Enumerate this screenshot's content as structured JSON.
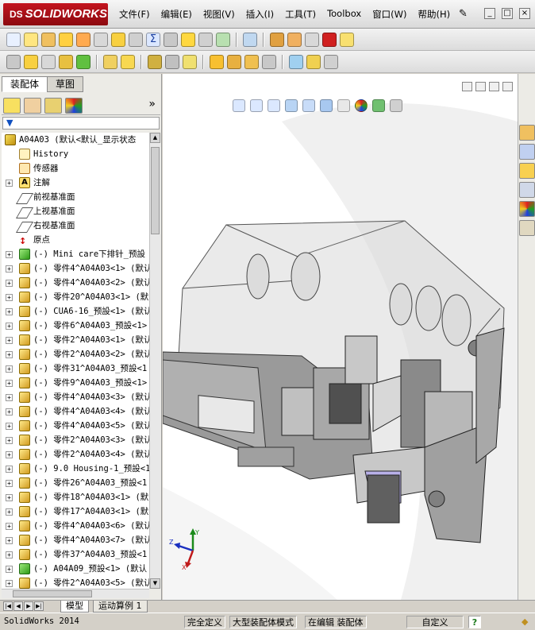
{
  "app": {
    "logo_prefix": "DS",
    "logo_text": "SOLIDWORKS"
  },
  "menu": [
    "文件(F)",
    "编辑(E)",
    "视图(V)",
    "插入(I)",
    "工具(T)",
    "Toolbox",
    "窗口(W)",
    "帮助(H)"
  ],
  "panel": {
    "tabs": [
      {
        "label": "装配体",
        "active": true
      },
      {
        "label": "草图",
        "active": false
      }
    ],
    "more_label": "»"
  },
  "tree": [
    {
      "label": "A04A03  (默认<默认_显示状态",
      "icon": "assembly",
      "expand": "",
      "indent": 0
    },
    {
      "label": "History",
      "icon": "history",
      "expand": "",
      "indent": 1
    },
    {
      "label": "传感器",
      "icon": "sensor",
      "expand": "",
      "indent": 1
    },
    {
      "label": "注解",
      "icon": "note",
      "expand": "+",
      "indent": 1
    },
    {
      "label": "前视基准面",
      "icon": "plane",
      "expand": "",
      "indent": 1
    },
    {
      "label": "上视基准面",
      "icon": "plane",
      "expand": "",
      "indent": 1
    },
    {
      "label": "右视基准面",
      "icon": "plane",
      "expand": "",
      "indent": 1
    },
    {
      "label": "原点",
      "icon": "origin",
      "expand": "",
      "indent": 1
    },
    {
      "label": "(-) Mini care下排针_预設",
      "icon": "assembly-g",
      "expand": "+",
      "indent": 1
    },
    {
      "label": "(-) 零件4^A04A03<1> (默认",
      "icon": "part",
      "expand": "+",
      "indent": 1
    },
    {
      "label": "(-) 零件4^A04A03<2> (默认",
      "icon": "part",
      "expand": "+",
      "indent": 1
    },
    {
      "label": "(-) 零件20^A04A03<1> (默",
      "icon": "part",
      "expand": "+",
      "indent": 1
    },
    {
      "label": "(-) CUA6-16_预設<1> (默认",
      "icon": "part",
      "expand": "+",
      "indent": 1
    },
    {
      "label": "(-) 零件6^A04A03_预設<1>",
      "icon": "part",
      "expand": "+",
      "indent": 1
    },
    {
      "label": "(-) 零件2^A04A03<1> (默认",
      "icon": "part",
      "expand": "+",
      "indent": 1
    },
    {
      "label": "(-) 零件2^A04A03<2> (默认",
      "icon": "part",
      "expand": "+",
      "indent": 1
    },
    {
      "label": "(-) 零件31^A04A03_预設<1",
      "icon": "part",
      "expand": "+",
      "indent": 1
    },
    {
      "label": "(-) 零件9^A04A03_预設<1>",
      "icon": "part",
      "expand": "+",
      "indent": 1
    },
    {
      "label": "(-) 零件4^A04A03<3> (默认",
      "icon": "part",
      "expand": "+",
      "indent": 1
    },
    {
      "label": "(-) 零件4^A04A03<4> (默认",
      "icon": "part",
      "expand": "+",
      "indent": 1
    },
    {
      "label": "(-) 零件4^A04A03<5> (默认",
      "icon": "part",
      "expand": "+",
      "indent": 1
    },
    {
      "label": "(-) 零件2^A04A03<3> (默认",
      "icon": "part",
      "expand": "+",
      "indent": 1
    },
    {
      "label": "(-) 零件2^A04A03<4> (默认",
      "icon": "part",
      "expand": "+",
      "indent": 1
    },
    {
      "label": "(-) 9.0 Housing-1_预設<1",
      "icon": "part",
      "expand": "+",
      "indent": 1
    },
    {
      "label": "(-) 零件26^A04A03_预設<1",
      "icon": "part",
      "expand": "+",
      "indent": 1
    },
    {
      "label": "(-) 零件18^A04A03<1> (默",
      "icon": "part",
      "expand": "+",
      "indent": 1
    },
    {
      "label": "(-) 零件17^A04A03<1> (默",
      "icon": "part",
      "expand": "+",
      "indent": 1
    },
    {
      "label": "(-) 零件4^A04A03<6> (默认",
      "icon": "part",
      "expand": "+",
      "indent": 1
    },
    {
      "label": "(-) 零件4^A04A03<7> (默认",
      "icon": "part",
      "expand": "+",
      "indent": 1
    },
    {
      "label": "(-) 零件37^A04A03_预設<1",
      "icon": "part",
      "expand": "+",
      "indent": 1
    },
    {
      "label": "(-) A04A09_预設<1> (默认",
      "icon": "assembly-g",
      "expand": "+",
      "indent": 1
    },
    {
      "label": "(-) 零件2^A04A03<5> (默认",
      "icon": "part",
      "expand": "+",
      "indent": 1
    }
  ],
  "bottom_tabs": [
    {
      "label": "模型"
    },
    {
      "label": "运动算例 1"
    }
  ],
  "status": {
    "app": "SolidWorks 2014",
    "cells": [
      "完全定义",
      "大型装配体模式",
      "在编辑 装配体",
      "自定义"
    ]
  },
  "triad": {
    "x": "X",
    "y": "Y",
    "z": "Z"
  },
  "colors": {
    "brand_red": "#c3141e",
    "toolbar_bg": "#e6e6e6",
    "panel_bg": "#ecebe6"
  }
}
